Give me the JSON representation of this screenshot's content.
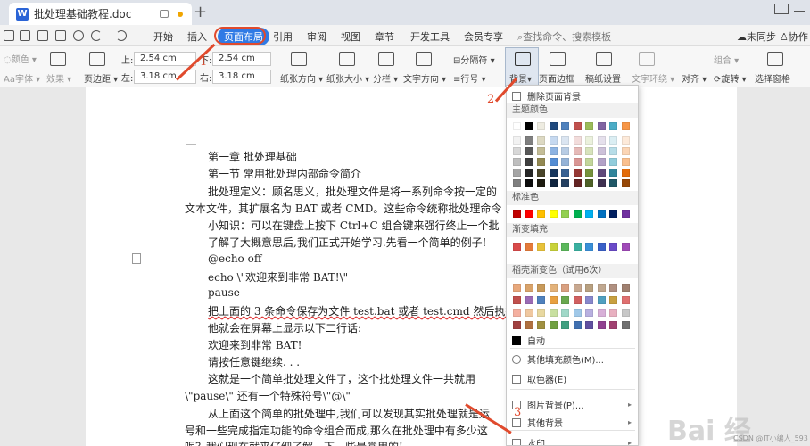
{
  "window": {
    "tab_title": "批处理基础教程.doc",
    "doc_icon": "W",
    "new_tab": "+"
  },
  "menu": {
    "items": [
      "开始",
      "插入",
      "页面布局",
      "引用",
      "审阅",
      "视图",
      "章节",
      "开发工具",
      "会员专享"
    ],
    "active": "页面布局",
    "search": "查找命令、搜索模板",
    "sync": "未同步",
    "collab": "协作"
  },
  "ribbon": {
    "color": "颜色",
    "font": "字体",
    "effect": "效果",
    "margins": "页边距",
    "top_prefix": "上:",
    "top_value": "2.54 cm",
    "bottom_prefix": "下:",
    "bottom_value": "2.54 cm",
    "left_prefix": "左:",
    "left_value": "3.18 cm",
    "right_prefix": "右:",
    "right_value": "3.18 cm",
    "orientation": "纸张方向",
    "size": "纸张大小",
    "columns": "分栏",
    "text_direction": "文字方向",
    "line_numbers": "行号",
    "separator": "分隔符",
    "background": "背景",
    "page_border": "页面边框",
    "manuscript": "稿纸设置",
    "text_wrap": "文字环绕",
    "align": "对齐",
    "rotate": "旋转",
    "selection_pane": "选择窗格",
    "group": "组合"
  },
  "document": {
    "lines": [
      "第一章  批处理基础",
      "第一节  常用批处理内部命令简介",
      "批处理定义：顾名思义，批处理文件是将一系列命令按一定的",
      "文本文件，其扩展名为 BAT 或者 CMD。这些命令统称批处理命令",
      "小知识：可以在键盘上按下 Ctrl+C 组合键来强行终止一个批",
      "了解了大概意思后,我们正式开始学习.先看一个简单的例子!",
      "@echo off",
      "echo \\\"欢迎来到非常 BAT!\\\"",
      "pause",
      "把上面的 3 条命令保存为文件 test.bat 或者 test.cmd 然后执行",
      "他就会在屏幕上显示以下二行话:",
      "欢迎来到非常 BAT!",
      "请按任意键继续. . .",
      "这就是一个简单批处理文件了，这个批处理文件一共就用",
      "\\\"pause\\\"  还有一个特殊符号\\\"@\\\"",
      "从上面这个简单的批处理中,我们可以发现其实批处理就是运",
      "号和一些完成指定功能的命令组合而成,那么在批处理中有多少这",
      "呢？我们现在就来仔细了解一下一些最常用的!"
    ]
  },
  "dropdown": {
    "remove_bg": "删除页面背景",
    "theme_colors": "主题颜色",
    "standard_colors": "标准色",
    "gradient_fill": "渐变填充",
    "shell_gradient": "稻壳渐变色（试用6次）",
    "auto": "自动",
    "other_fill": "其他填充颜色(M)...",
    "eyedropper": "取色器(E)",
    "picture_bg": "图片背景(P)...",
    "other_bg": "其他背景",
    "watermark": "水印",
    "theme_rows": [
      [
        "#ffffff",
        "#000000",
        "#eeece1",
        "#1f497d",
        "#4f81bd",
        "#c0504d",
        "#9bbb59",
        "#8064a2",
        "#4bacc6",
        "#f79646"
      ],
      [
        "#f2f2f2",
        "#7f7f7f",
        "#ddd9c3",
        "#c6d9f0",
        "#dbe5f1",
        "#f2dcdb",
        "#ebf1dd",
        "#e5e0ec",
        "#dbeef3",
        "#fdeada"
      ],
      [
        "#d8d8d8",
        "#595959",
        "#c4bd97",
        "#8db3e2",
        "#b8cce4",
        "#e5b9b7",
        "#d7e3bc",
        "#ccc1d9",
        "#b7dde8",
        "#fbd5b5"
      ],
      [
        "#bfbfbf",
        "#3f3f3f",
        "#938953",
        "#548dd4",
        "#95b3d7",
        "#d99694",
        "#c3d69b",
        "#b2a2c7",
        "#92cddc",
        "#fac08f"
      ],
      [
        "#a5a5a5",
        "#262626",
        "#494429",
        "#17365d",
        "#366092",
        "#953734",
        "#76923c",
        "#5f497a",
        "#31859b",
        "#e36c09"
      ],
      [
        "#7f7f7f",
        "#0c0c0c",
        "#1d1b10",
        "#0f243e",
        "#244061",
        "#632423",
        "#4f6128",
        "#3f3151",
        "#205867",
        "#974806"
      ]
    ],
    "standard_row": [
      "#c00000",
      "#ff0000",
      "#ffc000",
      "#ffff00",
      "#92d050",
      "#00b050",
      "#00b0f0",
      "#0070c0",
      "#002060",
      "#7030a0"
    ],
    "gradient_row": [
      "#d94a4a",
      "#e57b3a",
      "#e8c23a",
      "#c8d23a",
      "#5cb85c",
      "#3ab0a0",
      "#3a90d8",
      "#3a60c8",
      "#6a4ac8",
      "#a04ab8"
    ],
    "shell_rows": [
      [
        "#e8a87c",
        "#d9a36a",
        "#c89a5a",
        "#e3b27a",
        "#d9a080",
        "#c8a890",
        "#b8a080",
        "#c0a890",
        "#b09080",
        "#a08070"
      ],
      [
        "#c0504d",
        "#9b6bb5",
        "#4f81bd",
        "#e8a040",
        "#6aa84f",
        "#d06060",
        "#8888cc",
        "#50a0c0",
        "#c8a040",
        "#e07070"
      ],
      [
        "#f4b0a0",
        "#f0c8a0",
        "#e8d8a0",
        "#c8e0a0",
        "#a0d8c8",
        "#a0c8e8",
        "#b8b0e0",
        "#d8b0d8",
        "#e8b0c0",
        "#c8c8c8"
      ],
      [
        "#a04040",
        "#b07040",
        "#a09040",
        "#70a040",
        "#40a080",
        "#4070b0",
        "#6050a0",
        "#904090",
        "#a04070",
        "#707070"
      ]
    ]
  },
  "annotations": [
    "1",
    "2",
    "3"
  ],
  "watermark_text": "Bai 经",
  "watermark_sub": "CSDN @IT小编人_593"
}
